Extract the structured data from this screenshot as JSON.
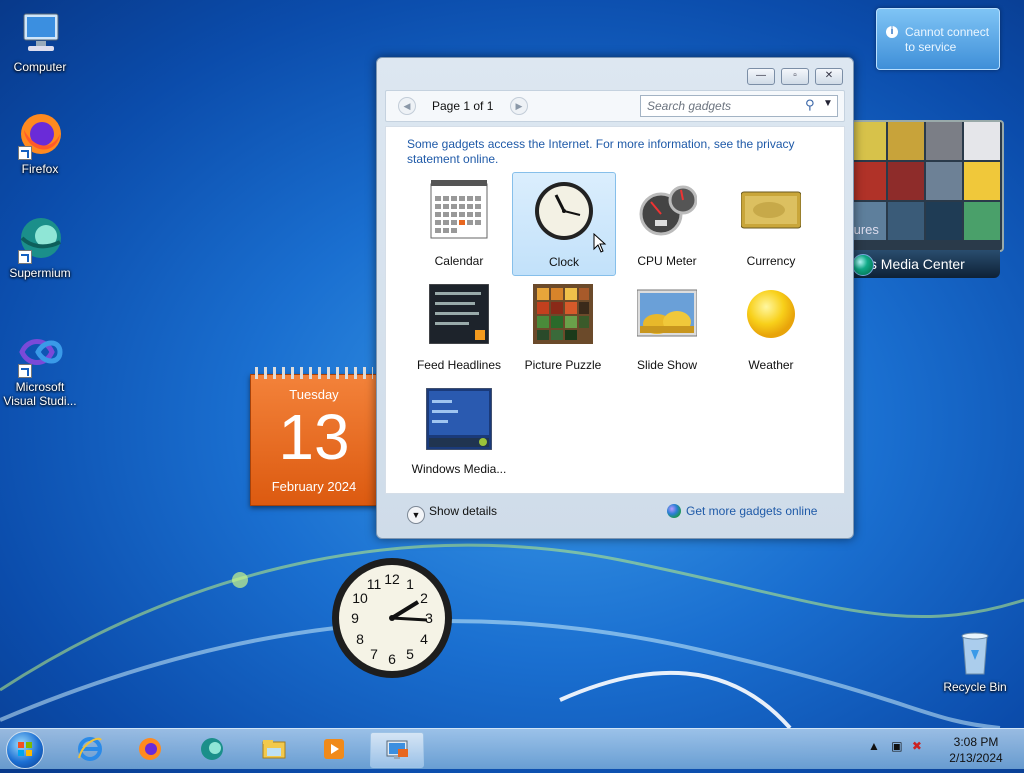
{
  "desktop": {
    "icons": [
      {
        "label": "Computer"
      },
      {
        "label": "Firefox"
      },
      {
        "label": "Supermium"
      },
      {
        "label": "Microsoft Visual Studi..."
      },
      {
        "label": "Recycle Bin"
      }
    ]
  },
  "notification": {
    "text": "Cannot connect to service"
  },
  "media_center_gadget": {
    "title": "ows Media Center",
    "label": "tures"
  },
  "calendar_gadget": {
    "weekday": "Tuesday",
    "day": "13",
    "month_year": "February 2024"
  },
  "gadget_window": {
    "pager": "Page 1 of 1",
    "search_placeholder": "Search gadgets",
    "notice": "Some gadgets access the Internet.  For more information, see the privacy statement online.",
    "gadgets": [
      {
        "label": "Calendar"
      },
      {
        "label": "Clock"
      },
      {
        "label": "CPU Meter"
      },
      {
        "label": "Currency"
      },
      {
        "label": "Feed Headlines"
      },
      {
        "label": "Picture Puzzle"
      },
      {
        "label": "Slide Show"
      },
      {
        "label": "Weather"
      },
      {
        "label": "Windows Media..."
      }
    ],
    "show_details": "Show details",
    "get_more": "Get more gadgets online"
  },
  "taskbar": {
    "time": "3:08 PM",
    "date": "2/13/2024",
    "items": [
      "internet-explorer-icon",
      "firefox-icon",
      "supermium-icon",
      "file-explorer-icon",
      "media-player-icon",
      "gadgets-icon"
    ]
  },
  "colors": {
    "link": "#1f5aa8",
    "selection": "#c2e1fa",
    "calendar": "#e8671f"
  }
}
